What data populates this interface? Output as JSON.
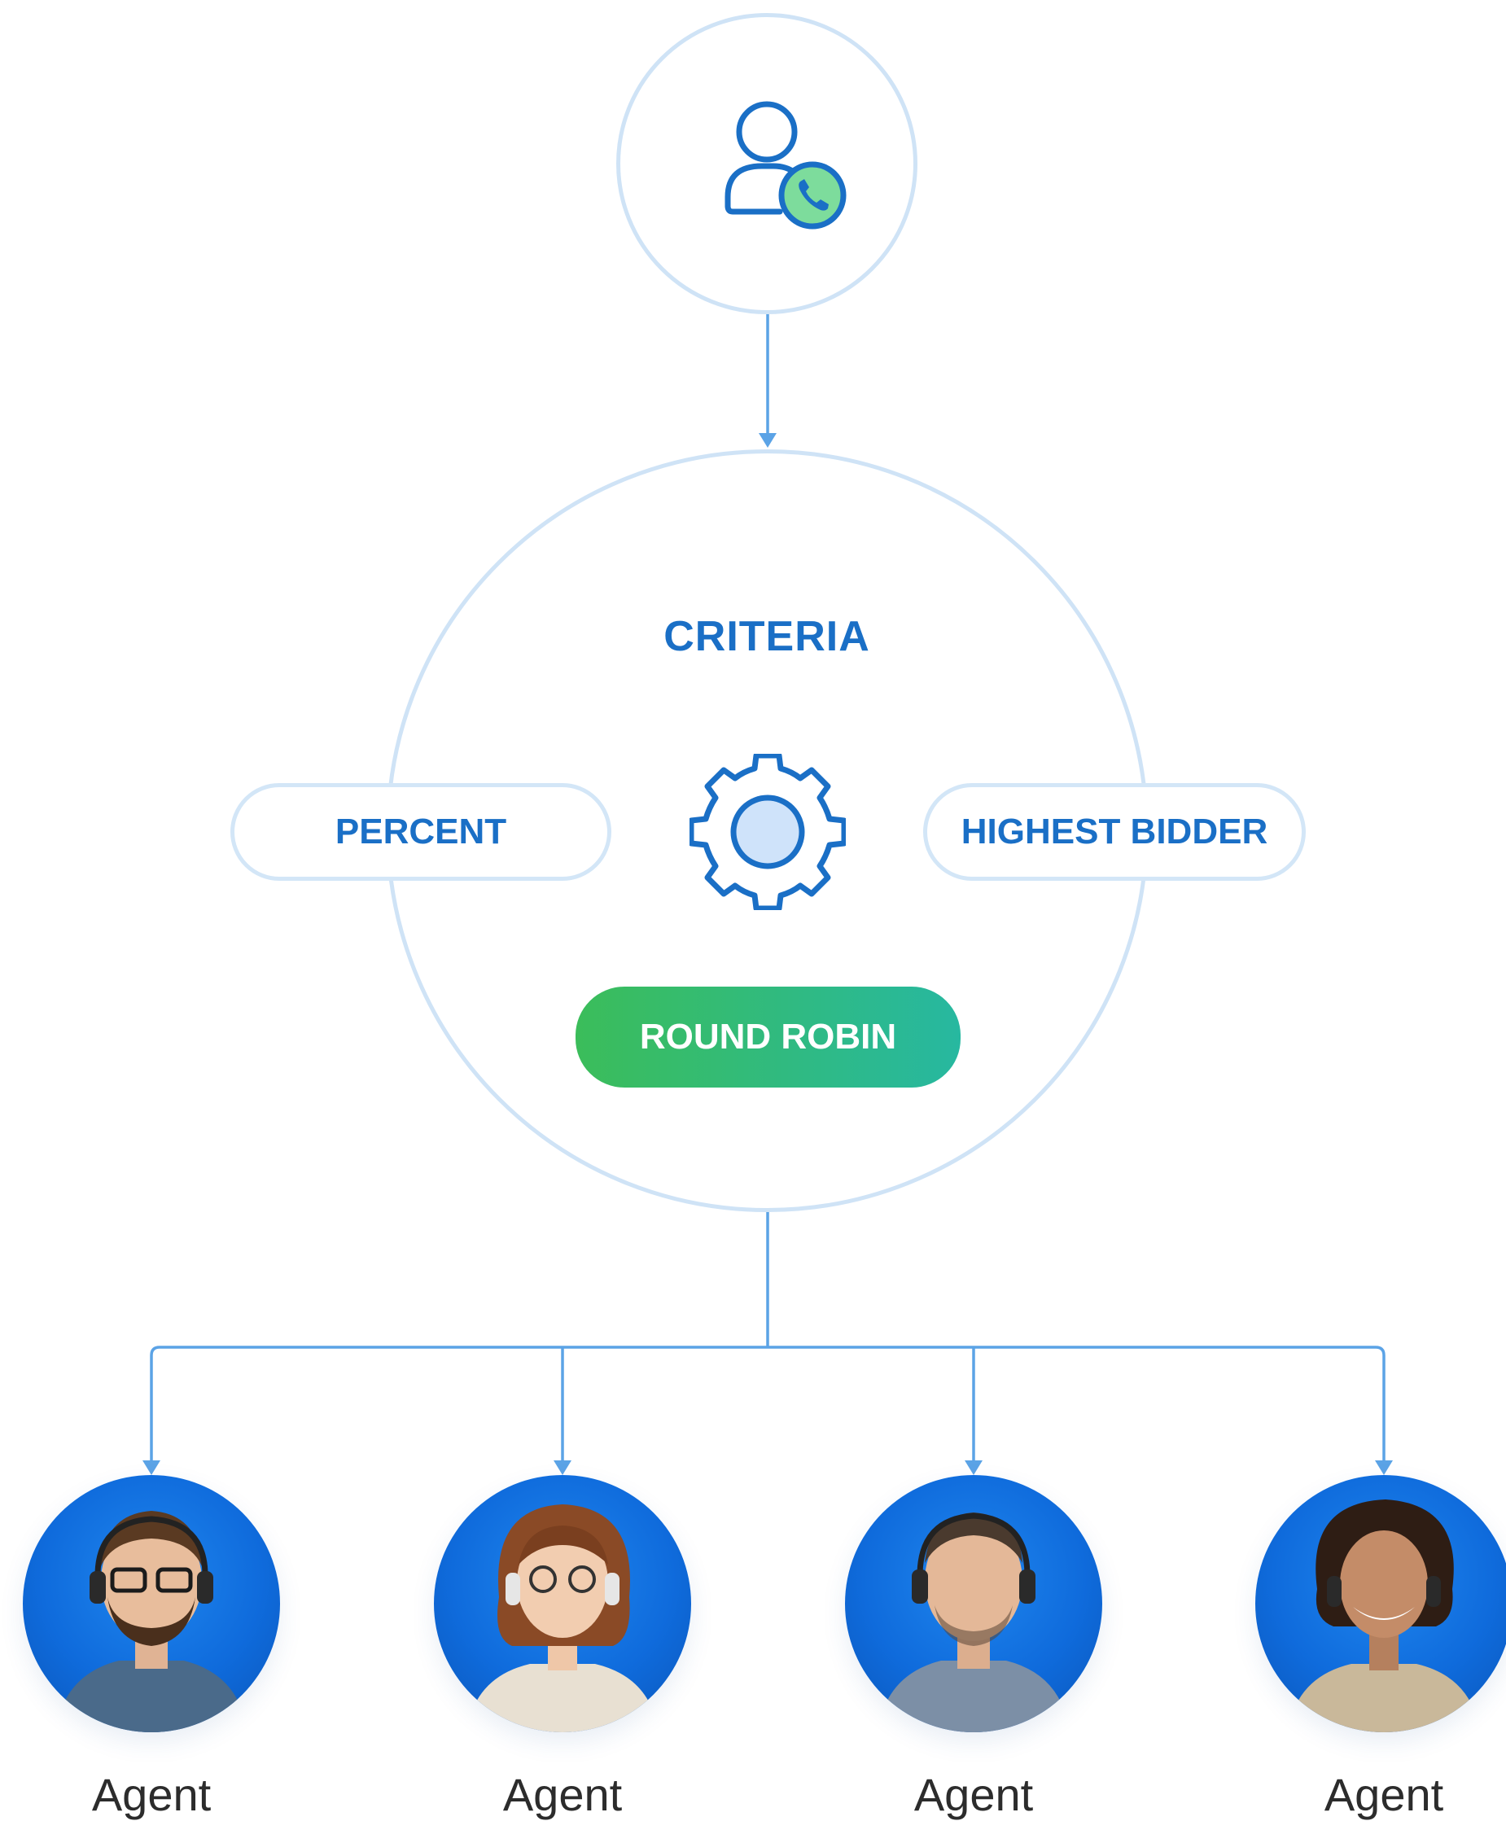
{
  "criteria": {
    "title": "CRITERIA",
    "options": {
      "percent": "PERCENT",
      "highest_bidder": "HIGHEST BIDDER",
      "round_robin": "ROUND ROBIN"
    }
  },
  "agents": [
    {
      "label": "Agent"
    },
    {
      "label": "Agent"
    },
    {
      "label": "Agent"
    },
    {
      "label": "Agent"
    }
  ],
  "icons": {
    "caller": "user-phone-icon",
    "criteria": "gear-icon",
    "agent": "agent-avatar"
  },
  "colors": {
    "accent": "#1a6fc6",
    "circle_border": "#cfe3f6",
    "connector": "#5ba3e6",
    "round_robin_start": "#3bbd5a",
    "round_robin_end": "#27b8a0",
    "avatar_bg": "#0f6bdc",
    "phone_badge": "#7ddc9c"
  }
}
